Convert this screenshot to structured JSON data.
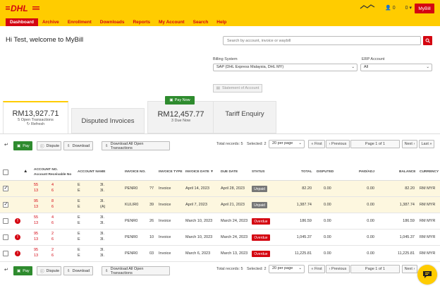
{
  "header": {
    "logo": "DHL",
    "user_count": "0",
    "cart_count": "0",
    "mybill_label": "MyBill"
  },
  "nav": [
    "Dashboard",
    "Archive",
    "Enrollment",
    "Downloads",
    "Reports",
    "My Account",
    "Search",
    "Help"
  ],
  "welcome": "Hi Test, welcome to MyBill",
  "search": {
    "placeholder": "Search by account, invoice or waybill"
  },
  "billing_system": {
    "label": "Billing System",
    "value": "SAP (DHL Express Malaysia, DHL MY)"
  },
  "erp_account": {
    "label": "ERP Account",
    "value": "All"
  },
  "statement_button": "Statement of Account",
  "cards": {
    "open": {
      "amount": "RM13,927.71",
      "sub": "5 Open Transactions",
      "refresh": "Refresh"
    },
    "disputed": {
      "title": "Disputed Invoices"
    },
    "due": {
      "paynow": "Pay Now",
      "amount": "RM12,457.77",
      "sub": "3 Due Now"
    },
    "tariff": {
      "title": "Tariff Enquiry"
    }
  },
  "toolbar": {
    "pay": "Pay",
    "dispute": "Dispute",
    "download": "Download",
    "download_all": "Download All Open Transactions",
    "total_records": "Total records: 5",
    "selected": "Selected: 2",
    "per_page": "20 per page",
    "first": "« First",
    "previous": "‹ Previous",
    "page": "Page 1 of 1",
    "next": "Next ›",
    "last": "Last »"
  },
  "columns": {
    "account_no": "ACCOUNT NO.",
    "account_recv": "Account Receivable No",
    "account_name": "ACCOUNT NAME",
    "invoice_no": "INVOICE NO.",
    "invoice_type": "INVOICE TYPE",
    "invoice_date": "INVOICE DATE",
    "due_date": "DUE DATE",
    "status": "STATUS",
    "total": "TOTAL",
    "disputed": "DISPUTED",
    "paid_adj": "PAID/ADJ",
    "balance": "BALANCE",
    "currency": "CURRENCY"
  },
  "rows": [
    {
      "acc1": "55",
      "acc2": "4",
      "recv1": "13",
      "recv2": "6",
      "name1": "E",
      "name2": "E",
      "name3": "3I.",
      "name4": "3I.",
      "inv": "PENR0",
      "inv_suffix": "?7",
      "type": "Invoice",
      "date": "April 14, 2023",
      "due": "April 28, 2023",
      "status": "Unpaid",
      "total": "82.20",
      "disputed": "0.00",
      "paid": "0.00",
      "balance": "82.20",
      "currency": "RM MYR"
    },
    {
      "acc1": "95",
      "acc2": "8",
      "recv1": "13",
      "recv2": "6",
      "name1": "E",
      "name2": "E",
      "name3": "3I.",
      "name4": "(A)",
      "inv": "KULIR0",
      "inv_suffix": "39",
      "type": "Invoice",
      "date": "April 7, 2023",
      "due": "April 21, 2023",
      "status": "Unpaid",
      "total": "1,387.74",
      "disputed": "0.00",
      "paid": "0.00",
      "balance": "1,387.74",
      "currency": "RM MYR"
    },
    {
      "acc1": "55",
      "acc2": "4",
      "recv1": "13",
      "recv2": "6",
      "name1": "E",
      "name2": "E",
      "name3": "3I.",
      "name4": "3I.",
      "inv": "PENR0",
      "inv_suffix": "26",
      "type": "Invoice",
      "date": "March 10, 2023",
      "due": "March 24, 2023",
      "status": "Overdue",
      "total": "186.59",
      "disputed": "0.00",
      "paid": "0.00",
      "balance": "186.59",
      "currency": "RM MYR"
    },
    {
      "acc1": "95",
      "acc2": "2",
      "recv1": "13",
      "recv2": "6",
      "name1": "E",
      "name2": "E",
      "name3": "3I.",
      "name4": "3I.",
      "inv": "PENR0",
      "inv_suffix": "10",
      "type": "Invoice",
      "date": "March 10, 2023",
      "due": "March 24, 2023",
      "status": "Overdue",
      "total": "1,045.37",
      "disputed": "0.00",
      "paid": "0.00",
      "balance": "1,045.37",
      "currency": "RM MYR"
    },
    {
      "acc1": "95",
      "acc2": "2",
      "recv1": "13",
      "recv2": "6",
      "name1": "E",
      "name2": "E",
      "name3": "3I.",
      "name4": "3I.",
      "inv": "PENR0",
      "inv_suffix": "03",
      "type": "Invoice",
      "date": "March 6, 2023",
      "due": "March 13, 2023",
      "status": "Overdue",
      "total": "11,225.81",
      "disputed": "0.00",
      "paid": "0.00",
      "balance": "11,225.81",
      "currency": "RM MYR"
    }
  ],
  "colors": {
    "brand_yellow": "#ffcc00",
    "brand_red": "#d40511",
    "pay_green": "#2e8b2e"
  }
}
